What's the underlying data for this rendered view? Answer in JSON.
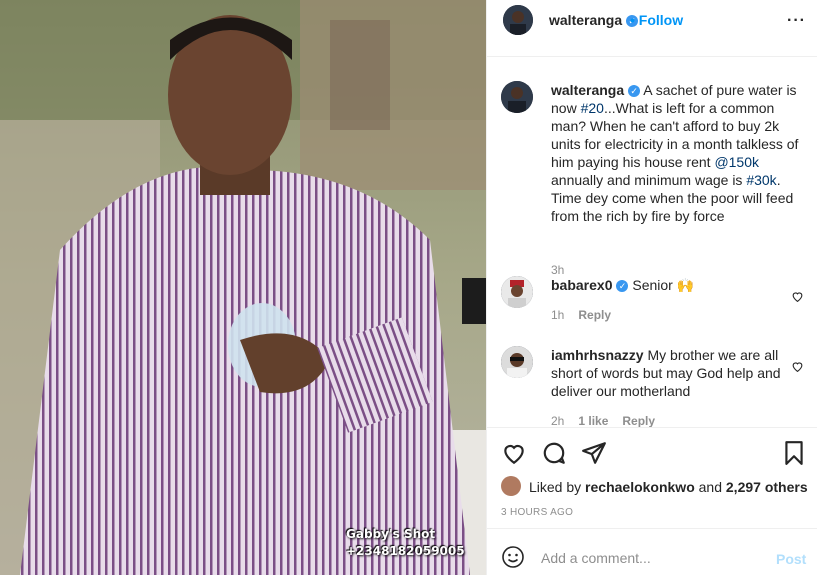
{
  "post": {
    "author": "walteranga",
    "follow_label": "Follow",
    "more_icon": "more-options-icon",
    "watermark_line1": "Gabby's Shot",
    "watermark_line2": "+2348182059005"
  },
  "caption": {
    "username": "walteranga",
    "text_a": " A sachet of pure water is now ",
    "tag1": "#20",
    "text_b": "...What is left for a common man? When he can't afford to buy 2k units for electricity in a month talkless of him paying his house rent ",
    "tag2": "@150k",
    "text_c": " annually and minimum wage is ",
    "tag3": "#30k",
    "text_d": ". Time dey come when the poor will feed from the rich by fire by force",
    "age": "3h"
  },
  "comments": [
    {
      "username": "babarex0",
      "text": " Senior 🙌",
      "age": "1h",
      "reply": "Reply",
      "verified": true
    },
    {
      "username": "iamhrhsnazzy",
      "text": " My brother we are all short of words but may God help and deliver our motherland",
      "age": "2h",
      "likes": "1 like",
      "reply": "Reply",
      "verified": false
    }
  ],
  "likes": {
    "prefix": "Liked by ",
    "user": "rechaelokonkwo",
    "middle": " and ",
    "count": "2,297 others"
  },
  "timestamp": "3 HOURS AGO",
  "add_comment": {
    "placeholder": "Add a comment...",
    "post_label": "Post"
  },
  "colors": {
    "link": "#00376b",
    "accent": "#0095f6",
    "verified": "#3897f0",
    "post_disabled": "#b2dffc"
  }
}
